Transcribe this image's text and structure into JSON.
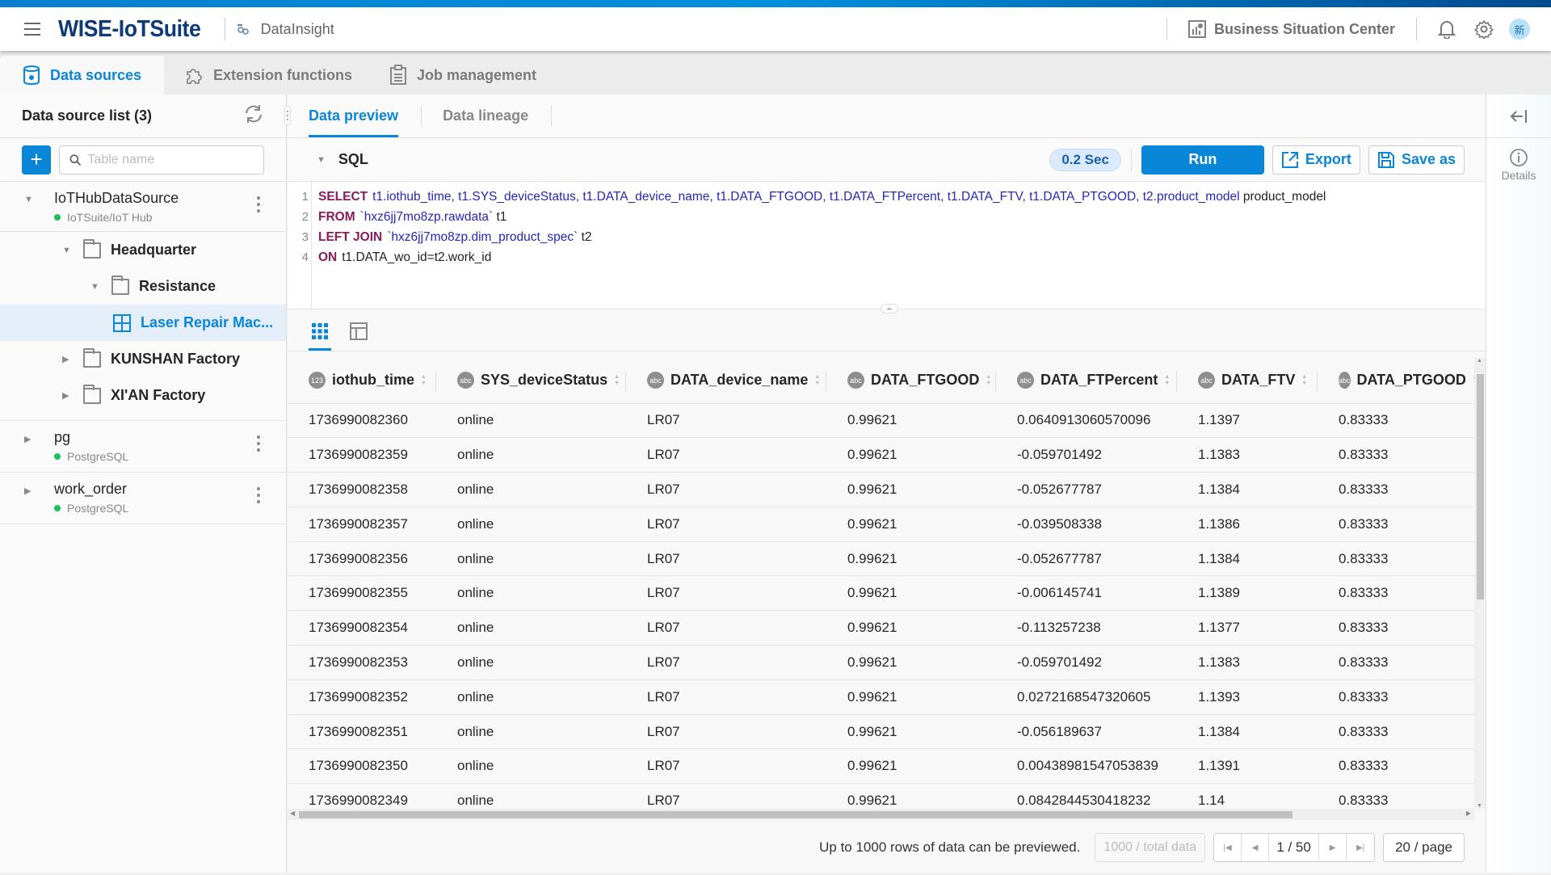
{
  "header": {
    "brand": "WISE-IoTSuite",
    "app_name": "DataInsight",
    "business_center": "Business Situation Center",
    "avatar_text": "新"
  },
  "main_tabs": [
    {
      "label": "Data sources",
      "icon": "database-icon",
      "active": true
    },
    {
      "label": "Extension functions",
      "icon": "puzzle-icon",
      "active": false
    },
    {
      "label": "Job management",
      "icon": "clipboard-icon",
      "active": false
    }
  ],
  "sidebar": {
    "title": "Data source list (3)",
    "search_placeholder": "Table name",
    "search_value": "",
    "datasources": [
      {
        "name": "IoTHubDataSource",
        "type": "IoTSuite/IoT Hub",
        "status_color": "#1ec25a",
        "expanded": true,
        "nodes": [
          {
            "label": "Headquarter",
            "level": 1,
            "kind": "folder",
            "expanded": true
          },
          {
            "label": "Resistance",
            "level": 2,
            "kind": "folder",
            "expanded": true
          },
          {
            "label": "Laser Repair Mac...",
            "level": 3,
            "kind": "table",
            "selected": true
          },
          {
            "label": "KUNSHAN Factory",
            "level": 1,
            "kind": "folder",
            "expanded": false
          },
          {
            "label": "XI'AN Factory",
            "level": 1,
            "kind": "folder",
            "expanded": false
          }
        ]
      },
      {
        "name": "pg",
        "type": "PostgreSQL",
        "status_color": "#1ec25a",
        "expanded": false
      },
      {
        "name": "work_order",
        "type": "PostgreSQL",
        "status_color": "#1ec25a",
        "expanded": false
      }
    ]
  },
  "preview_tabs": [
    {
      "label": "Data preview",
      "active": true
    },
    {
      "label": "Data lineage",
      "active": false
    }
  ],
  "sql": {
    "label": "SQL",
    "exec_time": "0.2 Sec",
    "run_label": "Run",
    "export_label": "Export",
    "save_as_label": "Save as",
    "lines": [
      {
        "n": "1",
        "kw": "SELECT",
        "rest": "t1.iothub_time, t1.SYS_deviceStatus, t1.DATA_device_name, t1.DATA_FTGOOD, t1.DATA_FTPercent, t1.DATA_FTV, t1.DATA_PTGOOD, t2.product_model",
        "tail": "product_model"
      },
      {
        "n": "2",
        "kw": "FROM",
        "rest": "`hxz6jj7mo8zp.rawdata`",
        "tail": "t1"
      },
      {
        "n": "3",
        "kw": "LEFT JOIN",
        "rest": "`hxz6jj7mo8zp.dim_product_spec`",
        "tail": "t2"
      },
      {
        "n": "4",
        "kw": "ON",
        "rest": "t1.DATA_wo_id=t2.work_id",
        "tail": ""
      }
    ]
  },
  "table": {
    "columns": [
      {
        "name": "iothub_time",
        "type": "123"
      },
      {
        "name": "SYS_deviceStatus",
        "type": "abc"
      },
      {
        "name": "DATA_device_name",
        "type": "abc"
      },
      {
        "name": "DATA_FTGOOD",
        "type": "abc"
      },
      {
        "name": "DATA_FTPercent",
        "type": "abc"
      },
      {
        "name": "DATA_FTV",
        "type": "abc"
      },
      {
        "name": "DATA_PTGOOD",
        "type": "abc"
      }
    ],
    "rows": [
      [
        "1736990082360",
        "online",
        "LR07",
        "0.99621",
        "0.0640913060570096",
        "1.1397",
        "0.83333"
      ],
      [
        "1736990082359",
        "online",
        "LR07",
        "0.99621",
        "-0.059701492",
        "1.1383",
        "0.83333"
      ],
      [
        "1736990082358",
        "online",
        "LR07",
        "0.99621",
        "-0.052677787",
        "1.1384",
        "0.83333"
      ],
      [
        "1736990082357",
        "online",
        "LR07",
        "0.99621",
        "-0.039508338",
        "1.1386",
        "0.83333"
      ],
      [
        "1736990082356",
        "online",
        "LR07",
        "0.99621",
        "-0.052677787",
        "1.1384",
        "0.83333"
      ],
      [
        "1736990082355",
        "online",
        "LR07",
        "0.99621",
        "-0.006145741",
        "1.1389",
        "0.83333"
      ],
      [
        "1736990082354",
        "online",
        "LR07",
        "0.99621",
        "-0.113257238",
        "1.1377",
        "0.83333"
      ],
      [
        "1736990082353",
        "online",
        "LR07",
        "0.99621",
        "-0.059701492",
        "1.1383",
        "0.83333"
      ],
      [
        "1736990082352",
        "online",
        "LR07",
        "0.99621",
        "0.0272168547320605",
        "1.1393",
        "0.83333"
      ],
      [
        "1736990082351",
        "online",
        "LR07",
        "0.99621",
        "-0.056189637",
        "1.1384",
        "0.83333"
      ],
      [
        "1736990082350",
        "online",
        "LR07",
        "0.99621",
        "0.00438981547053839",
        "1.1391",
        "0.83333"
      ],
      [
        "1736990082349",
        "online",
        "LR07",
        "0.99621",
        "0.0842844530418232",
        "1.14",
        "0.83333"
      ]
    ]
  },
  "pager": {
    "info": "Up to 1000 rows of data can be previewed.",
    "total": "1000 / total data",
    "current": "1 / 50",
    "page_size": "20 / page"
  },
  "right_rail": {
    "details_label": "Details"
  },
  "colors": {
    "accent": "#0a86d8",
    "brand": "#0e3a78",
    "status_online": "#1ec25a"
  }
}
